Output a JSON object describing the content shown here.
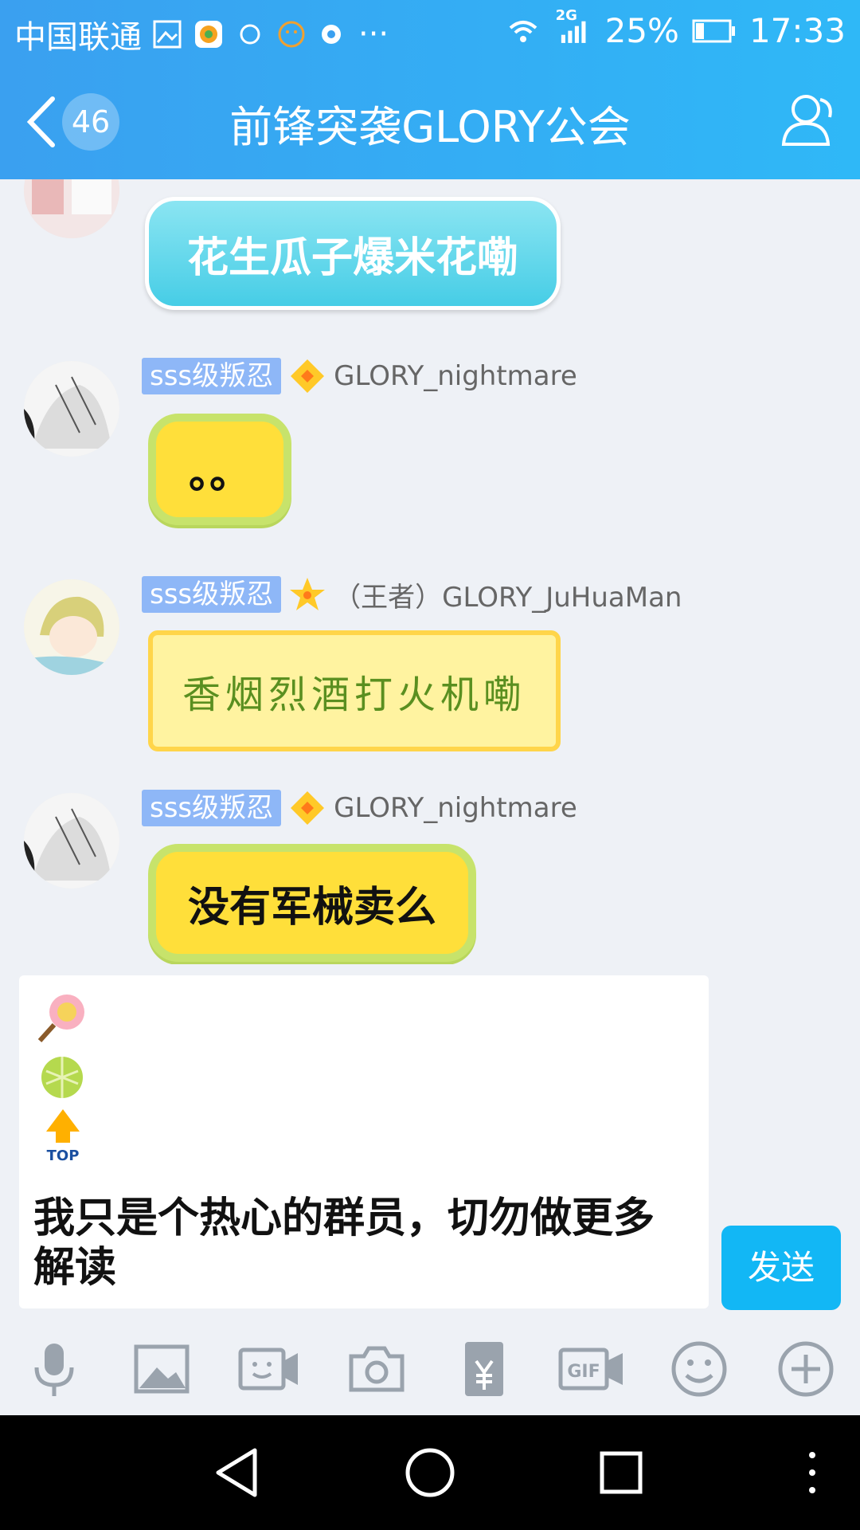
{
  "status_bar": {
    "carrier": "中国联通",
    "network": "2G",
    "battery": "25%",
    "time": "17:33",
    "more": "···"
  },
  "header": {
    "back_count": "46",
    "title": "前锋突袭GLORY公会"
  },
  "messages": [
    {
      "bubble_text": "花生瓜子爆米花嘞",
      "style": "blue"
    },
    {
      "level": "sss级叛忍",
      "rank_icon": "diamond-icon",
      "name": "GLORY_nightmare",
      "bubble_text": "。。",
      "style": "lemon"
    },
    {
      "level": "sss级叛忍",
      "rank_icon": "star-icon",
      "name": "（王者）GLORY_JuHuaMan",
      "bubble_text": "香烟烈酒打火机嘞",
      "style": "fancy"
    },
    {
      "level": "sss级叛忍",
      "rank_icon": "diamond-icon",
      "name": "GLORY_nightmare",
      "bubble_text": "没有军械卖么",
      "style": "lemon"
    }
  ],
  "input": {
    "sticker_top_label": "TOP",
    "text": "我只是个热心的群员，切勿做更多解读"
  },
  "send_label": "发送",
  "toolbar": [
    "mic-icon",
    "image-icon",
    "video-call-icon",
    "camera-icon",
    "red-packet-icon",
    "gif-icon",
    "emoji-icon",
    "plus-icon"
  ],
  "colors": {
    "header": "#2fb8f7",
    "send": "#12b7f5",
    "level_badge": "#8eb7f7",
    "bubble_lemon": "#ffdf3a"
  }
}
